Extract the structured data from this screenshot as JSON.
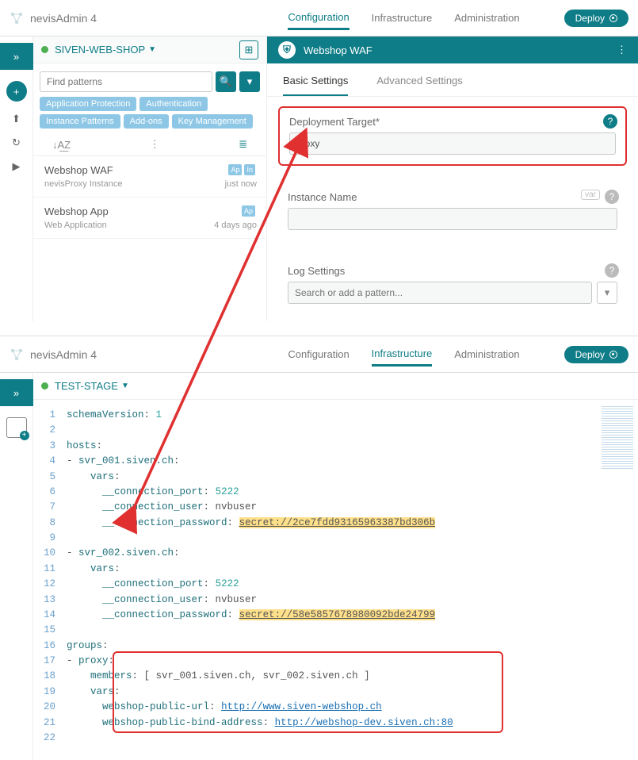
{
  "brand": "nevisAdmin 4",
  "nav": {
    "config": "Configuration",
    "infra": "Infrastructure",
    "admin": "Administration",
    "deploy": "Deploy"
  },
  "project": {
    "name": "SIVEN-WEB-SHOP"
  },
  "search": {
    "placeholder": "Find patterns"
  },
  "tags": [
    "Application Protection",
    "Authentication",
    "Instance Patterns",
    "Add-ons",
    "Key Management"
  ],
  "toolbar": {
    "sort": "↓A͟Z",
    "more": "⋮",
    "list": "≣"
  },
  "patterns": [
    {
      "name": "Webshop WAF",
      "sub": "nevisProxy Instance",
      "when": "just now",
      "badges": [
        "Ap",
        "In"
      ]
    },
    {
      "name": "Webshop App",
      "sub": "Web Application",
      "when": "4 days ago",
      "badges": [
        "Ap"
      ]
    }
  ],
  "detail": {
    "title": "Webshop WAF",
    "tabs": {
      "basic": "Basic Settings",
      "adv": "Advanced Settings"
    },
    "deployLabel": "Deployment Target*",
    "deployValue": "proxy",
    "instLabel": "Instance Name",
    "instValue": "",
    "logLabel": "Log Settings",
    "logPlaceholder": "Search or add a pattern...",
    "varBadge": "var"
  },
  "project2": {
    "name": "TEST-STAGE"
  },
  "code": {
    "lines": [
      {
        "n": 1,
        "t": [
          {
            "s": "schemaVersion",
            "c": "kw"
          },
          {
            "s": ": "
          },
          {
            "s": "1",
            "c": "num"
          }
        ]
      },
      {
        "n": 2,
        "t": []
      },
      {
        "n": 3,
        "t": [
          {
            "s": "hosts",
            "c": "kw"
          },
          {
            "s": ":"
          }
        ]
      },
      {
        "n": 4,
        "t": [
          {
            "s": "- "
          },
          {
            "s": "svr_001.siven.ch",
            "c": "kw"
          },
          {
            "s": ":"
          }
        ]
      },
      {
        "n": 5,
        "t": [
          {
            "s": "    "
          },
          {
            "s": "vars",
            "c": "kw"
          },
          {
            "s": ":"
          }
        ]
      },
      {
        "n": 6,
        "t": [
          {
            "s": "      "
          },
          {
            "s": "__connection_port",
            "c": "kw"
          },
          {
            "s": ": "
          },
          {
            "s": "5222",
            "c": "num"
          }
        ]
      },
      {
        "n": 7,
        "t": [
          {
            "s": "      "
          },
          {
            "s": "__connection_user",
            "c": "kw"
          },
          {
            "s": ": nvbuser"
          }
        ]
      },
      {
        "n": 8,
        "t": [
          {
            "s": "      "
          },
          {
            "s": "__connection_password",
            "c": "kw"
          },
          {
            "s": ": "
          },
          {
            "s": "secret://2ce7fdd93165963387bd306b",
            "c": "sec"
          }
        ]
      },
      {
        "n": 9,
        "t": []
      },
      {
        "n": 10,
        "t": [
          {
            "s": "- "
          },
          {
            "s": "svr_002.siven.ch",
            "c": "kw"
          },
          {
            "s": ":"
          }
        ]
      },
      {
        "n": 11,
        "t": [
          {
            "s": "    "
          },
          {
            "s": "vars",
            "c": "kw"
          },
          {
            "s": ":"
          }
        ]
      },
      {
        "n": 12,
        "t": [
          {
            "s": "      "
          },
          {
            "s": "__connection_port",
            "c": "kw"
          },
          {
            "s": ": "
          },
          {
            "s": "5222",
            "c": "num"
          }
        ]
      },
      {
        "n": 13,
        "t": [
          {
            "s": "      "
          },
          {
            "s": "__connection_user",
            "c": "kw"
          },
          {
            "s": ": nvbuser"
          }
        ]
      },
      {
        "n": 14,
        "t": [
          {
            "s": "      "
          },
          {
            "s": "__connection_password",
            "c": "kw"
          },
          {
            "s": ": "
          },
          {
            "s": "secret://58e5857678980092bde24799",
            "c": "sec"
          }
        ]
      },
      {
        "n": 15,
        "t": []
      },
      {
        "n": 16,
        "t": [
          {
            "s": "groups",
            "c": "kw"
          },
          {
            "s": ":"
          }
        ]
      },
      {
        "n": 17,
        "t": [
          {
            "s": "- "
          },
          {
            "s": "proxy",
            "c": "kw"
          },
          {
            "s": ":"
          }
        ]
      },
      {
        "n": 18,
        "t": [
          {
            "s": "    "
          },
          {
            "s": "members",
            "c": "kw"
          },
          {
            "s": ": [ svr_001.siven.ch, svr_002.siven.ch ]"
          }
        ]
      },
      {
        "n": 19,
        "t": [
          {
            "s": "    "
          },
          {
            "s": "vars",
            "c": "kw"
          },
          {
            "s": ":"
          }
        ]
      },
      {
        "n": 20,
        "t": [
          {
            "s": "      "
          },
          {
            "s": "webshop-public-url",
            "c": "kw"
          },
          {
            "s": ": "
          },
          {
            "s": "http://www.siven-webshop.ch",
            "c": "lnk"
          }
        ]
      },
      {
        "n": 21,
        "t": [
          {
            "s": "      "
          },
          {
            "s": "webshop-public-bind-address",
            "c": "kw"
          },
          {
            "s": ": "
          },
          {
            "s": "http://webshop-dev.siven.ch:80",
            "c": "lnk"
          }
        ]
      },
      {
        "n": 22,
        "t": []
      }
    ]
  }
}
